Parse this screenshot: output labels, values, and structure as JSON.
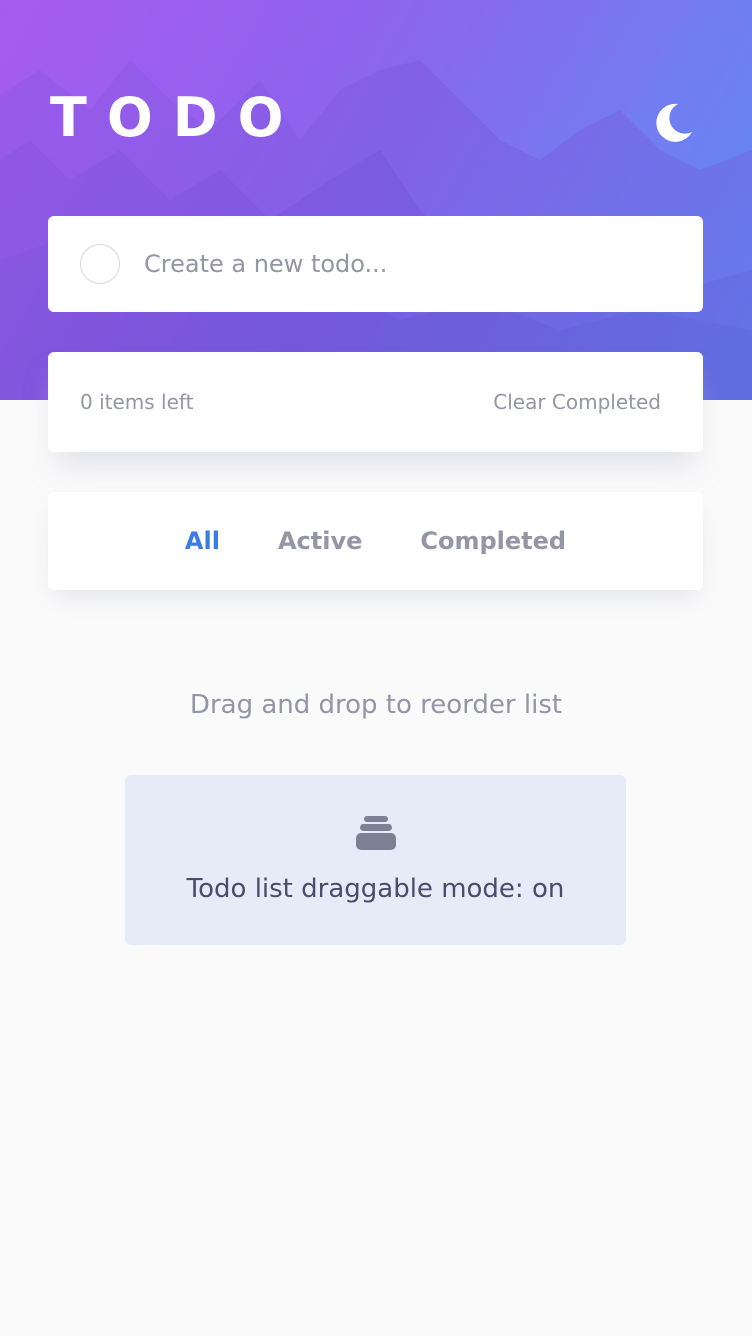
{
  "app": {
    "title": "TODO"
  },
  "header": {
    "theme_toggle_icon": "moon-icon"
  },
  "new_todo": {
    "placeholder": "Create a new todo...",
    "value": "",
    "checkbox_icon": "circle-icon"
  },
  "footer": {
    "items_left": "0 items left",
    "clear_label": "Clear Completed"
  },
  "filters": {
    "all": "All",
    "active": "Active",
    "completed": "Completed",
    "selected": "All"
  },
  "hint": "Drag and drop to reorder list",
  "drag_mode": {
    "icon": "stack-icon",
    "label": "Todo list draggable mode: on"
  },
  "colors": {
    "accent": "#3a7ce2",
    "muted_text": "#9495a5",
    "dark_text": "#494c6b",
    "page_bg": "#fafafa",
    "drag_panel_bg": "#e6ebf8"
  }
}
